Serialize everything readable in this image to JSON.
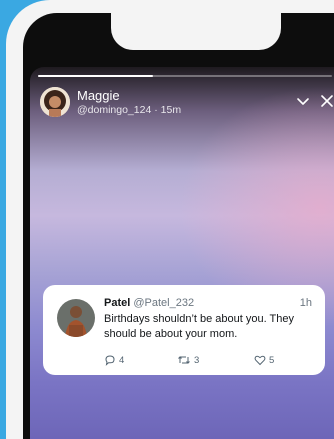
{
  "story": {
    "progress_fraction": 0.39,
    "author": {
      "name": "Maggie",
      "handle": "@domingo_124",
      "separator": " · ",
      "time": "15m"
    },
    "controls": [
      "chevron-down-icon",
      "close-icon"
    ]
  },
  "tweet": {
    "name": "Patel",
    "handle": "@Patel_232",
    "time": "1h",
    "text": "Birthdays shouldn’t be about you. They should be about your mom.",
    "replies": "4",
    "retweets": "3",
    "likes": "5"
  },
  "colors": {
    "background": "#3aa8e2",
    "card": "#ffffff",
    "text": "#14171a",
    "muted": "#536471"
  }
}
